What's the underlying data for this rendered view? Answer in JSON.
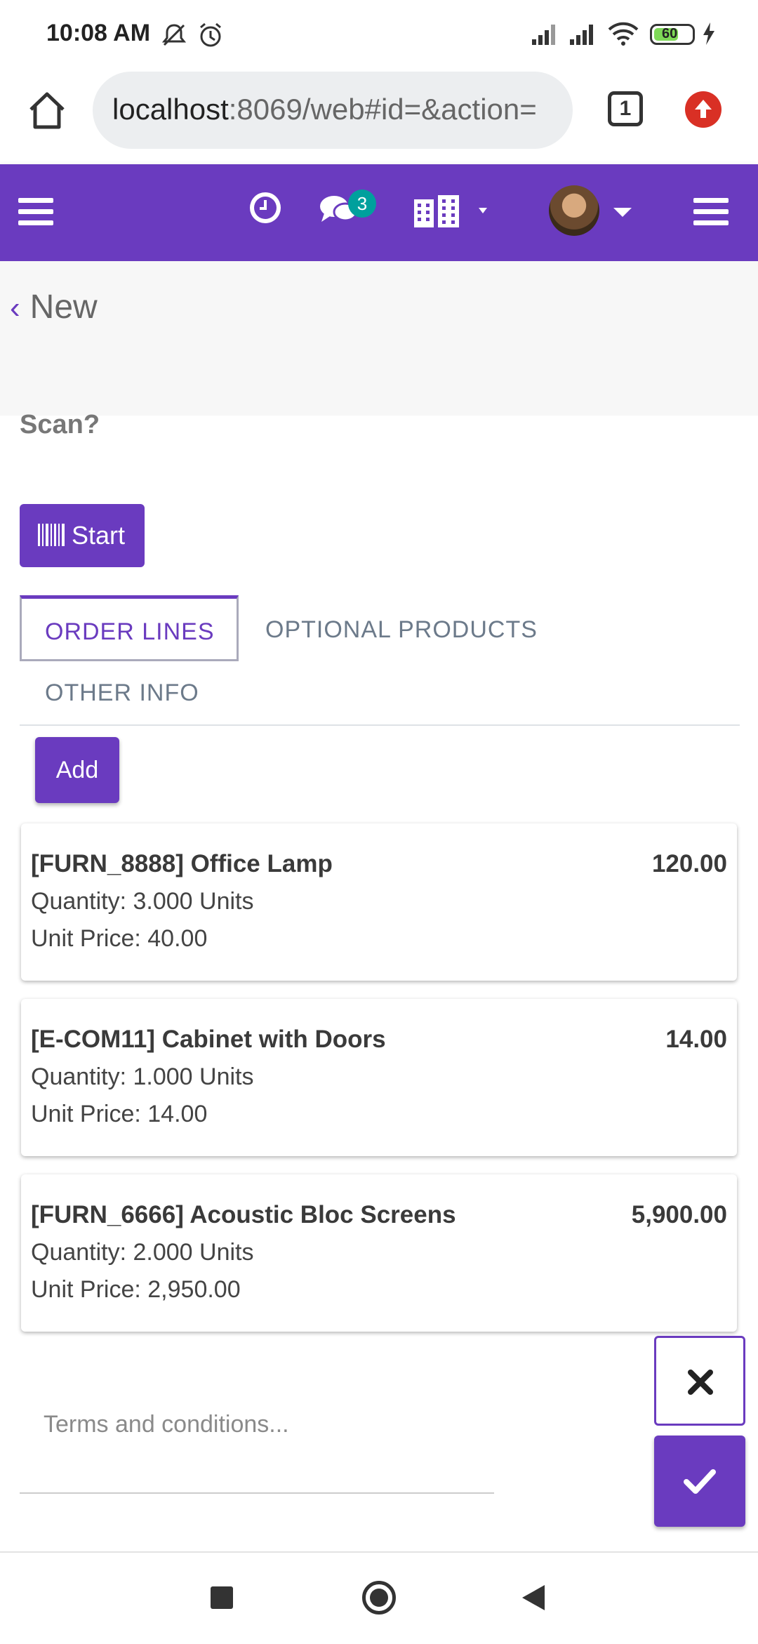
{
  "status_bar": {
    "time": "10:08 AM",
    "battery": "60"
  },
  "browser": {
    "url_host": "localhost",
    "url_rest": ":8069/web#id=&action=",
    "tab_count": "1"
  },
  "navbar": {
    "chat_badge_count": "3"
  },
  "breadcrumb": {
    "label": "New"
  },
  "form": {
    "scan_label": "Scan?",
    "start_button": "Start",
    "tabs": [
      {
        "label": "ORDER LINES",
        "active": true
      },
      {
        "label": "OPTIONAL PRODUCTS",
        "active": false
      },
      {
        "label": "OTHER INFO",
        "active": false
      }
    ],
    "add_button": "Add",
    "order_lines": [
      {
        "name": "[FURN_8888] Office Lamp",
        "total": "120.00",
        "quantity": "Quantity: 3.000 Units",
        "unit_price": "Unit Price: 40.00"
      },
      {
        "name": "[E-COM11] Cabinet with Doors",
        "total": "14.00",
        "quantity": "Quantity: 1.000 Units",
        "unit_price": "Unit Price: 14.00"
      },
      {
        "name": "[FURN_6666] Acoustic Bloc Screens",
        "total": "5,900.00",
        "quantity": "Quantity: 2.000 Units",
        "unit_price": "Unit Price: 2,950.00"
      }
    ],
    "terms_placeholder": "Terms and conditions..."
  },
  "colors": {
    "brand": "#6a3bbf",
    "badge": "#00a09d",
    "update": "#d93025"
  }
}
